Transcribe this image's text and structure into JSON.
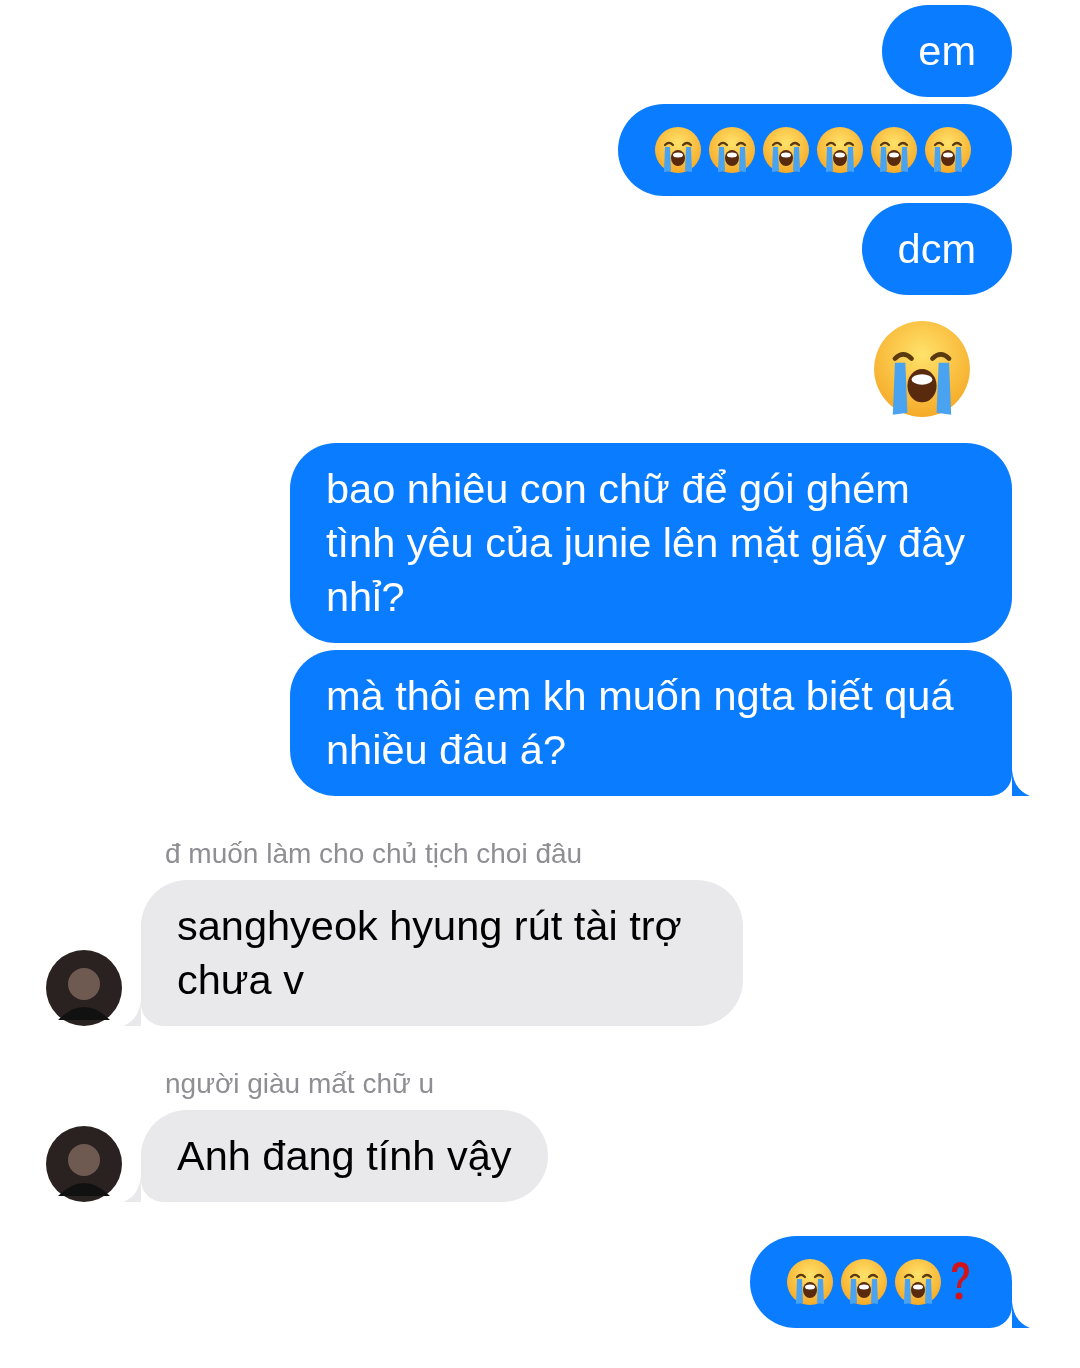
{
  "groups": [
    {
      "kind": "sent",
      "messages": [
        {
          "kind": "text",
          "text": "em",
          "tail": false
        },
        {
          "kind": "emoji",
          "tail": false,
          "icons": [
            {
              "kind": "crying-face"
            },
            {
              "kind": "crying-face"
            },
            {
              "kind": "crying-face"
            },
            {
              "kind": "crying-face"
            },
            {
              "kind": "crying-face"
            },
            {
              "kind": "crying-face"
            }
          ]
        },
        {
          "kind": "text",
          "text": "dcm",
          "tail": false
        }
      ]
    },
    {
      "kind": "sent",
      "messages": [
        {
          "kind": "big-emoji",
          "icons": [
            {
              "kind": "crying-face"
            }
          ]
        }
      ]
    },
    {
      "kind": "sent",
      "messages": [
        {
          "kind": "text",
          "text": "bao nhiêu con chữ để gói ghém tình yêu của junie lên mặt giấy đây nhỉ?",
          "tail": false
        },
        {
          "kind": "text",
          "text": "mà thôi em kh muốn ngta biết quá nhiều đâu á?",
          "tail": true
        }
      ]
    },
    {
      "kind": "received",
      "sender": "đ muốn làm cho chủ tịch choi đâu",
      "messages": [
        {
          "kind": "text",
          "text": "sanghyeok hyung rút tài trợ chưa v",
          "tail": true
        }
      ]
    },
    {
      "kind": "received",
      "sender": "người giàu mất chữ u",
      "messages": [
        {
          "kind": "text",
          "text": "Anh đang tính vậy",
          "tail": true
        }
      ]
    },
    {
      "kind": "sent",
      "messages": [
        {
          "kind": "emoji",
          "tail": true,
          "icons": [
            {
              "kind": "crying-face"
            },
            {
              "kind": "crying-face"
            },
            {
              "kind": "crying-face"
            },
            {
              "kind": "question-mark"
            }
          ]
        }
      ]
    }
  ]
}
